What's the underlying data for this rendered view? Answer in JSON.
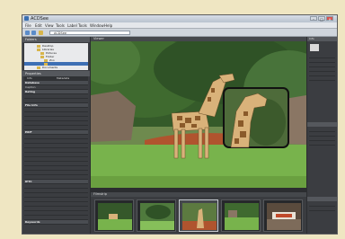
{
  "window": {
    "title": "ACDSee"
  },
  "menubar": [
    "File",
    "Edit",
    "View",
    "Tools",
    "Label",
    "Tools",
    "Window",
    "Help"
  ],
  "toolbar": {
    "path": "ACDSee"
  },
  "left_panel": {
    "folders_header": "Folders",
    "folders": [
      {
        "label": "Desktop",
        "selected": false
      },
      {
        "label": "Libraries",
        "selected": false
      },
      {
        "label": "Pictures",
        "selected": false
      },
      {
        "label": "Folder",
        "selected": false
      },
      {
        "label": "Zoo",
        "selected": false
      },
      {
        "label": "",
        "selected": true
      },
      {
        "label": "Documents",
        "selected": false
      }
    ],
    "properties_header": "Properties",
    "properties_tabs": [
      "Info",
      "Metadata"
    ],
    "rows": [
      {
        "label": "Database",
        "value": "",
        "section": true
      },
      {
        "label": "Caption",
        "value": "",
        "section": false
      },
      {
        "label": "Rating",
        "value": "",
        "section": true
      },
      {
        "label": "",
        "value": "",
        "section": false
      },
      {
        "label": "",
        "value": "",
        "section": false
      },
      {
        "label": "File Info",
        "value": "",
        "section": true
      },
      {
        "label": "",
        "value": "",
        "section": false
      },
      {
        "label": "",
        "value": "",
        "section": false
      },
      {
        "label": "",
        "value": "",
        "section": false
      },
      {
        "label": "",
        "value": "",
        "section": false
      },
      {
        "label": "",
        "value": "",
        "section": false
      },
      {
        "label": "EXIF",
        "value": "",
        "section": true
      },
      {
        "label": "",
        "value": "",
        "section": false
      },
      {
        "label": "",
        "value": "",
        "section": false
      },
      {
        "label": "",
        "value": "",
        "section": false
      },
      {
        "label": "",
        "value": "",
        "section": false
      },
      {
        "label": "",
        "value": "",
        "section": false
      },
      {
        "label": "",
        "value": "",
        "section": false
      },
      {
        "label": "",
        "value": "",
        "section": false
      },
      {
        "label": "",
        "value": "",
        "section": false
      },
      {
        "label": "",
        "value": "",
        "section": false
      },
      {
        "label": "",
        "value": "",
        "section": false
      },
      {
        "label": "IPTC",
        "value": "",
        "section": true
      },
      {
        "label": "",
        "value": "",
        "section": false
      },
      {
        "label": "",
        "value": "",
        "section": false
      },
      {
        "label": "",
        "value": "",
        "section": false
      },
      {
        "label": "",
        "value": "",
        "section": false
      },
      {
        "label": "",
        "value": "",
        "section": false
      },
      {
        "label": "",
        "value": "",
        "section": false
      },
      {
        "label": "",
        "value": "",
        "section": false
      },
      {
        "label": "",
        "value": "",
        "section": false
      },
      {
        "label": "Keywords",
        "value": "",
        "section": true
      }
    ]
  },
  "viewer": {
    "header": "Viewer",
    "caption": ""
  },
  "thumbnails": {
    "header": "Filmstrip",
    "count": 5,
    "selected_index": 2
  },
  "right_panel": {
    "header": "Info"
  },
  "colors": {
    "accent": "#3d6fb4",
    "panel": "#3b3d41",
    "background": "#efe6c2"
  }
}
